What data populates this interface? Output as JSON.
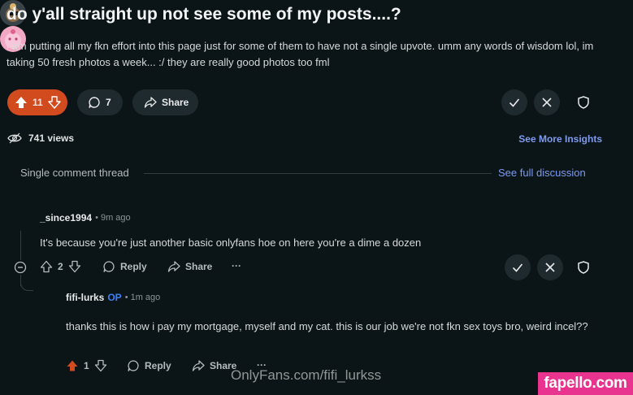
{
  "post": {
    "title": "do y'all straight up not see some of my posts....?",
    "body": "i am putting all my fkn effort into this page just for some of them to have not a single upvote. umm any words of wisdom lol, im taking 50 fresh photos a week... :/ they are really good photos too fml",
    "votes": "11",
    "comments": "7",
    "share_label": "Share",
    "views": "741 views",
    "insights_label": "See More Insights"
  },
  "thread": {
    "label": "Single comment thread",
    "full_label": "See full discussion"
  },
  "comment1": {
    "author": "_since1994",
    "time": "• 9m ago",
    "text": "It's because you're just another basic onlyfans hoe on here you're a dime a dozen",
    "votes": "2",
    "reply_label": "Reply",
    "share_label": "Share",
    "more_label": "···"
  },
  "comment2": {
    "author": "fifi-lurks",
    "op_badge": "OP",
    "time": "• 1m ago",
    "text": "thanks this is how i pay my mortgage, myself and my cat. this is our job we're not fkn sex toys bro, weird incel??",
    "votes": "1",
    "reply_label": "Reply",
    "share_label": "Share",
    "more_label": "···"
  },
  "overlay": {
    "watermark": "OnlyFans.com/fifi_lurkss",
    "badge": "fapello.com"
  },
  "colors": {
    "background": "#0b1416",
    "upvote_active": "#d24b1f",
    "link": "#7d9bf0",
    "op": "#3b82f6",
    "badge": "#e8348e"
  }
}
